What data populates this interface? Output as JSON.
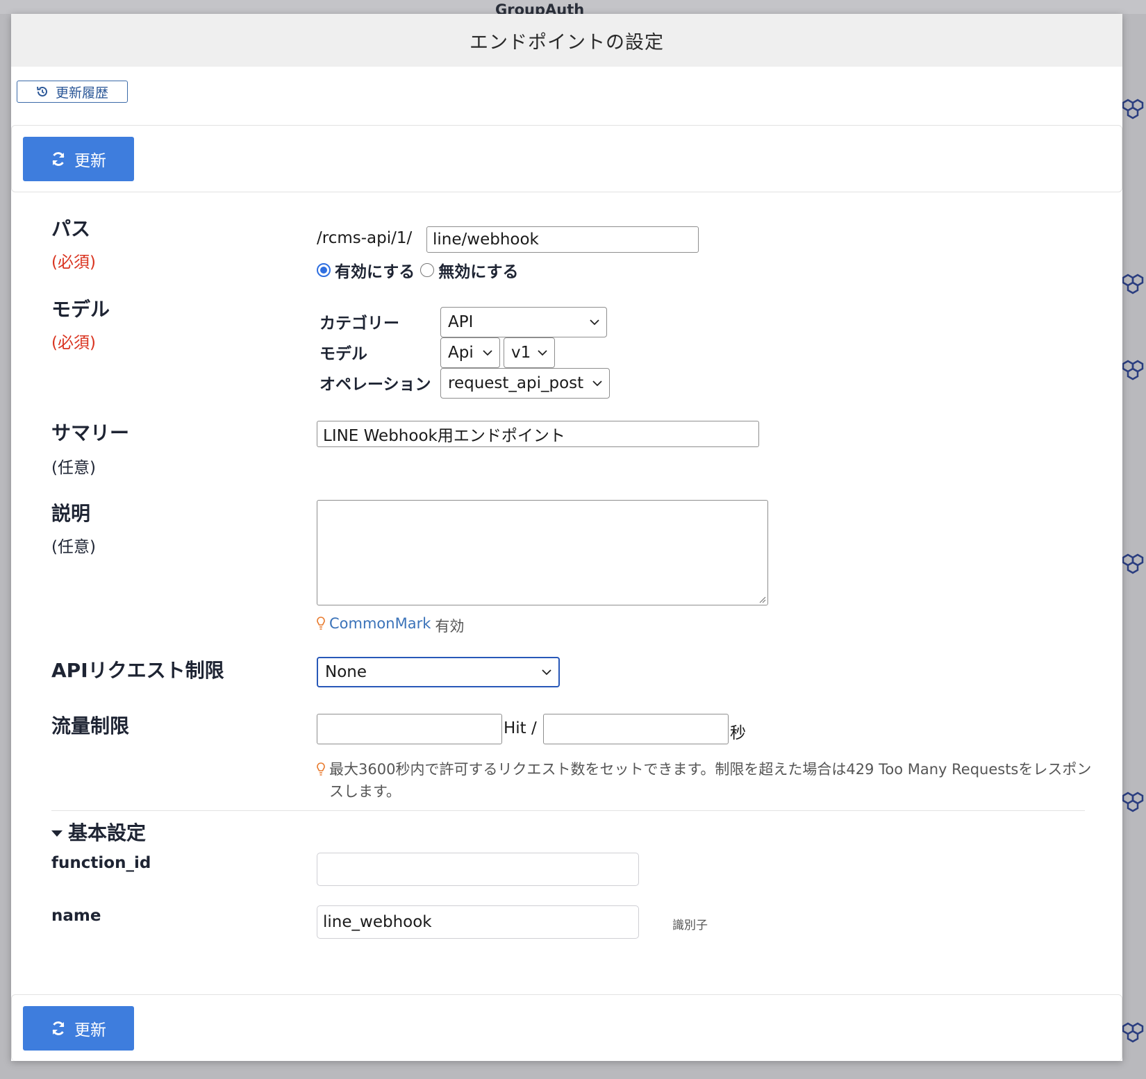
{
  "background": {
    "title": "GroupAuth"
  },
  "modal": {
    "title": "エンドポイントの設定",
    "history_button": "更新履歴",
    "update_button": "更新",
    "fields": {
      "path": {
        "label": "パス",
        "required": "(必須)",
        "prefix": "/rcms-api/1/",
        "value": "line/webhook",
        "enable_label": "有効にする",
        "disable_label": "無効にする",
        "enabled": true
      },
      "model": {
        "label": "モデル",
        "required": "(必須)",
        "category_label": "カテゴリー",
        "category_value": "API",
        "model_label": "モデル",
        "model_value": "Api",
        "version_value": "v1",
        "operation_label": "オペレーション",
        "operation_value": "request_api_post"
      },
      "summary": {
        "label": "サマリー",
        "optional": "(任意)",
        "value": "LINE Webhook用エンドポイント"
      },
      "description": {
        "label": "説明",
        "optional": "(任意)",
        "value": "",
        "hint_link": "CommonMark",
        "hint_text": "有効"
      },
      "api_limit": {
        "label": "APIリクエスト制限",
        "value": "None"
      },
      "rate_limit": {
        "label": "流量制限",
        "hits_value": "",
        "hit_unit": "Hit /",
        "seconds_value": "",
        "seconds_unit": "秒",
        "note": "最大3600秒内で許可するリクエスト数をセットできます。制限を超えた場合は429 Too Many Requestsをレスポンスします。"
      }
    },
    "basic_settings": {
      "title": "基本設定",
      "function_id_label": "function_id",
      "function_id_value": "",
      "name_label": "name",
      "name_value": "line_webhook",
      "name_help": "識別子"
    }
  },
  "colors": {
    "primary": "#3e7ddd",
    "required": "#d9331f",
    "link": "#3b73b9",
    "hint_icon": "#e8792b"
  },
  "icons": [
    "history-icon",
    "refresh-icon",
    "chevron-down-icon",
    "lightbulb-icon",
    "caret-down-icon",
    "cube-icon"
  ]
}
